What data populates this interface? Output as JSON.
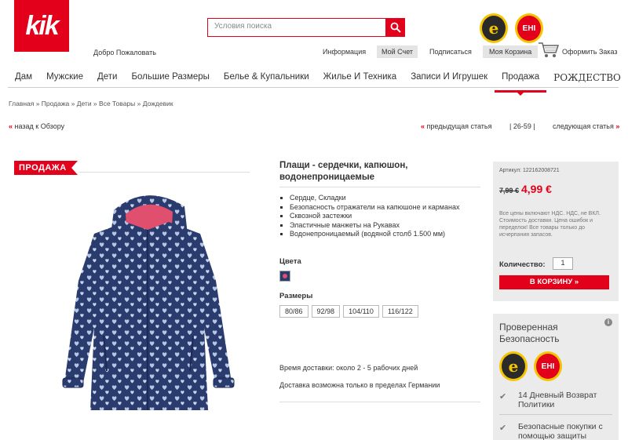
{
  "header": {
    "logo_text": "kik",
    "welcome": "Добро Пожаловать",
    "search_placeholder": "Условия поиска",
    "badge_trusted_letter": "e",
    "badge_ehi_text": "EHI"
  },
  "toplinks": {
    "info": "Информация",
    "account": "Мой Счет",
    "subscribe": "Подписаться",
    "cart": "Моя Корзина",
    "checkout": "Оформить Заказ"
  },
  "nav": {
    "items": [
      "Дам",
      "Мужские",
      "Дети",
      "Большие Размеры",
      "Белье & Купальники",
      "Жилье И Техника",
      "Записи И Игрушек",
      "Продажа",
      "РОЖДЕСТВО"
    ]
  },
  "breadcrumb": "Главная » Продажа » Дети » Все Товары » Дождевик",
  "pager": {
    "back": "назад к Обзору",
    "prev": "предыдущая статья",
    "counter": "| 26-59 |",
    "next": "следующая статья"
  },
  "product": {
    "sale_tag": "ПРОДАЖА",
    "title": "Плащи - сердечки, капюшон, водонепроницаемые",
    "features": [
      "Сердце, Складки",
      "Безопасность отражатели на капюшоне и карманах",
      "Сквозной застежки",
      "Эластичные манжеты на Рукавах",
      "Водонепроницаемый (водяной столб 1.500 мм)"
    ],
    "colors_label": "Цвета",
    "sizes_label": "Размеры",
    "sizes": [
      "80/86",
      "92/98",
      "104/110",
      "116/122"
    ],
    "delivery_time": "Время доставки: около 2 - 5 рабочих дней",
    "delivery_note": "Доставка возможна только в пределах Германии"
  },
  "buy": {
    "article": "Артикул: 122162008721",
    "old_price": "7,99 €",
    "new_price": "4,99 €",
    "vat_note": "Все цены включают НДС. НДС, не ВКЛ. Стоимость доставки. Цена ошибок и переделок! Все товары только до исчерпания запасов.",
    "qty_label": "Количество:",
    "qty_value": "1",
    "cart_button": "В КОРЗИНУ  »"
  },
  "trust": {
    "title": "Проверенная Безопасность",
    "info": "i",
    "items": [
      "14 Дневный Возврат Политики",
      "Безопасные покупки с помощью защиты"
    ]
  },
  "colors": {
    "brand_red": "#e2001a",
    "jacket_navy": "#2a3b6e",
    "lining_pink": "#e0506e"
  }
}
